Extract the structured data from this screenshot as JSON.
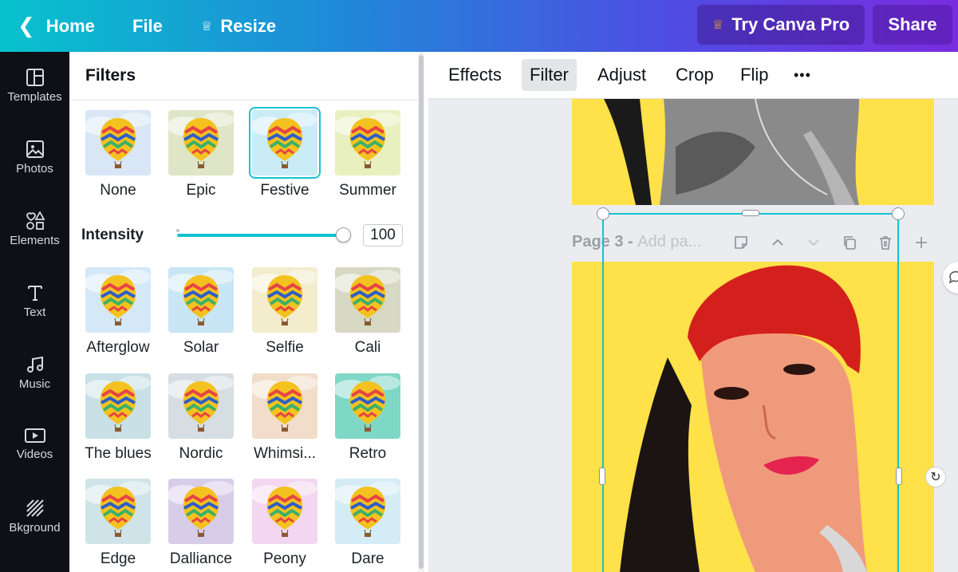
{
  "topbar": {
    "home": "Home",
    "file": "File",
    "resize": "Resize",
    "try_pro": "Try Canva Pro",
    "share": "Share"
  },
  "rail": [
    {
      "label": "Templates",
      "icon": "templates-icon"
    },
    {
      "label": "Photos",
      "icon": "photos-icon"
    },
    {
      "label": "Elements",
      "icon": "elements-icon"
    },
    {
      "label": "Text",
      "icon": "text-icon"
    },
    {
      "label": "Music",
      "icon": "music-icon"
    },
    {
      "label": "Videos",
      "icon": "videos-icon"
    },
    {
      "label": "Bkground",
      "icon": "background-icon"
    }
  ],
  "filters_panel": {
    "title": "Filters",
    "intensity_label": "Intensity",
    "intensity_value": "100",
    "intensity_fraction": 1.0,
    "selected_filter": "Festive",
    "filters": [
      {
        "label": "None",
        "tint": "#d8e6f5"
      },
      {
        "label": "Epic",
        "tint": "#dfe6c8"
      },
      {
        "label": "Festive",
        "tint": "#c9ecf7"
      },
      {
        "label": "Summer",
        "tint": "#e8f0c0"
      },
      {
        "label": "Afterglow",
        "tint": "#d5e8f7"
      },
      {
        "label": "Solar",
        "tint": "#c8e6f5"
      },
      {
        "label": "Selfie",
        "tint": "#f3eccd"
      },
      {
        "label": "Cali",
        "tint": "#d7d9c4"
      },
      {
        "label": "The blues",
        "tint": "#c8e0e6"
      },
      {
        "label": "Nordic",
        "tint": "#d6dde3"
      },
      {
        "label": "Whimsi...",
        "tint": "#f1ddc9"
      },
      {
        "label": "Retro",
        "tint": "#7fd8c6"
      },
      {
        "label": "Edge",
        "tint": "#cfe4e8"
      },
      {
        "label": "Dalliance",
        "tint": "#d8cde9"
      },
      {
        "label": "Peony",
        "tint": "#f3d6ef"
      },
      {
        "label": "Dare",
        "tint": "#d3ecf6"
      }
    ]
  },
  "toolbar": {
    "effects": "Effects",
    "filter": "Filter",
    "adjust": "Adjust",
    "crop": "Crop",
    "flip": "Flip",
    "more": "•••"
  },
  "canvas": {
    "page_label": "Page 3 - ",
    "page_title_placeholder": "Add pa..."
  },
  "colors": {
    "accent": "#13c4d2",
    "page_background": "#ffe14a"
  }
}
